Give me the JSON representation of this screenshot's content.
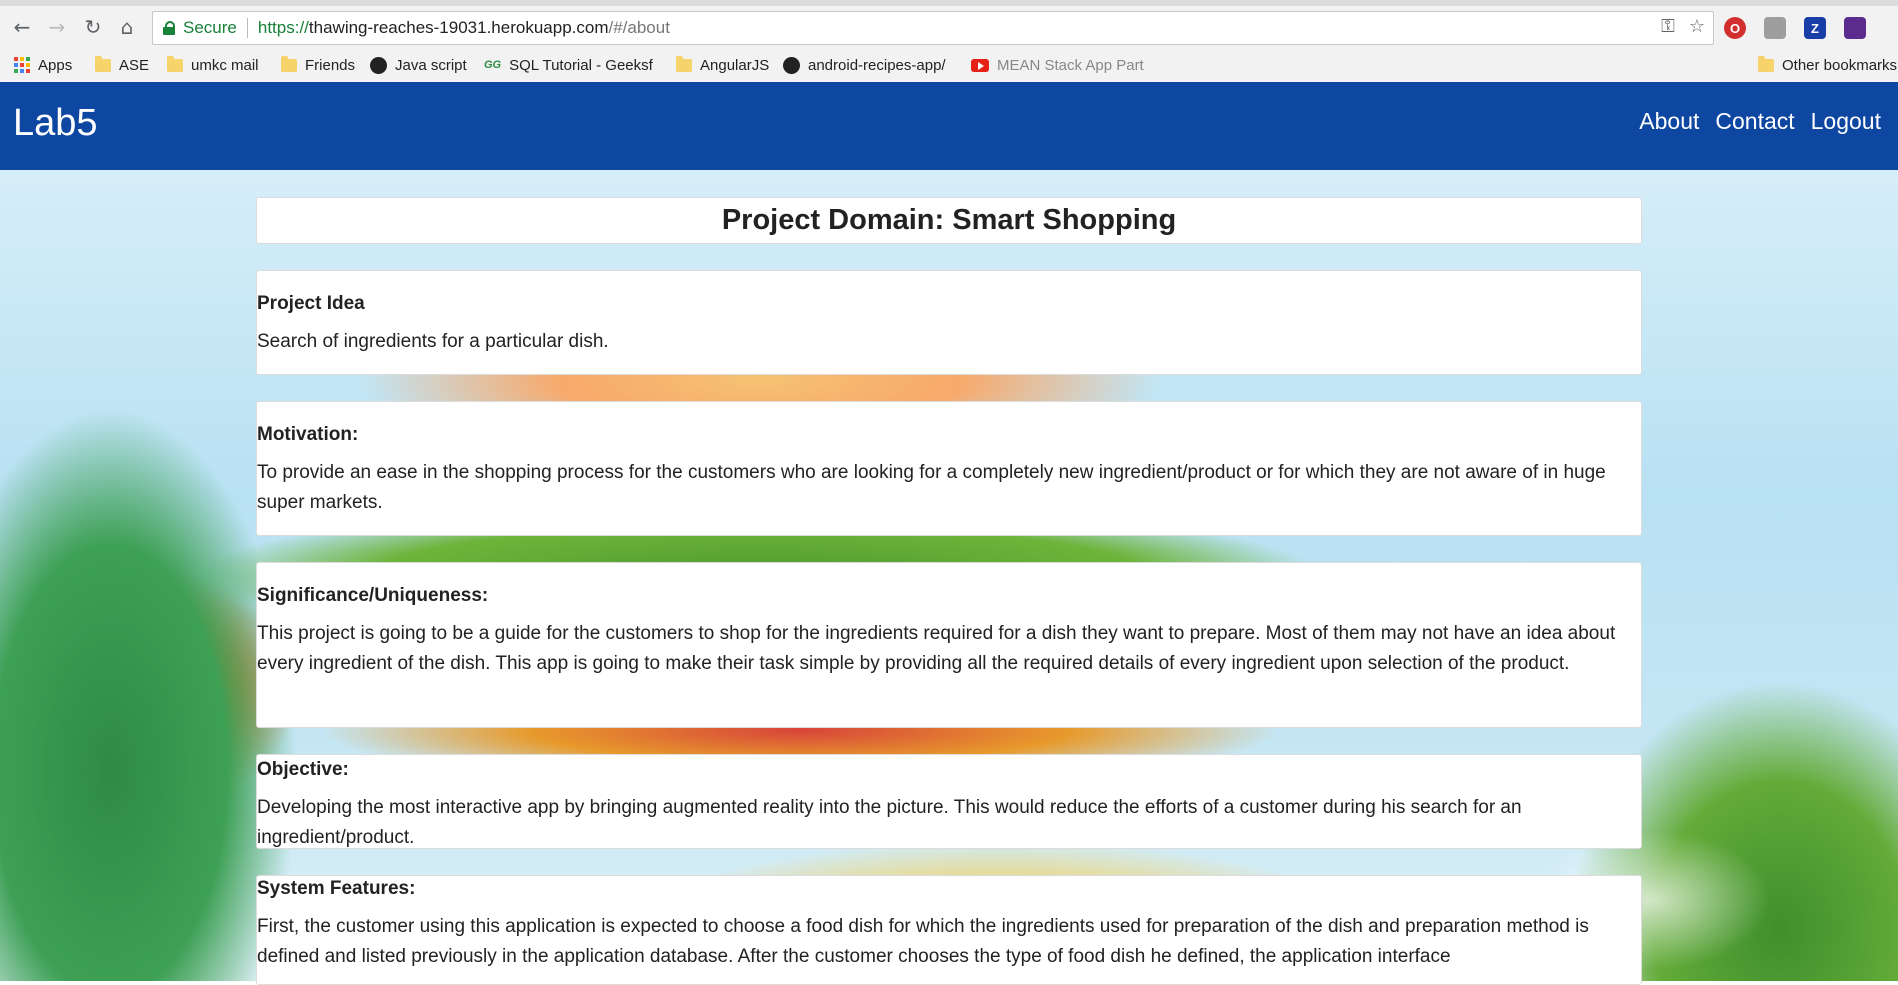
{
  "browser": {
    "security_label": "Secure",
    "url_scheme": "https://",
    "url_host": "thawing-reaches-19031.herokuapp.com",
    "url_path": "/#/about",
    "bookmarks": [
      "Apps",
      "ASE",
      "umkc mail",
      "Friends",
      "Java script",
      "SQL Tutorial - Geeksf",
      "AngularJS",
      "android-recipes-app/",
      "MEAN Stack App Part"
    ],
    "other_bookmarks": "Other bookmarks",
    "extensions": [
      "O",
      "",
      "Z",
      ""
    ]
  },
  "navbar": {
    "brand": "Lab5",
    "links": [
      "About",
      "Contact",
      "Logout"
    ]
  },
  "page": {
    "title": "Project Domain: Smart Shopping",
    "sections": [
      {
        "heading": "Project Idea",
        "body": "Search of ingredients for a particular dish."
      },
      {
        "heading": "Motivation:",
        "body": "To provide an ease in the shopping process for the customers who are looking for a completely new ingredient/product or for which they are not aware of in huge super markets."
      },
      {
        "heading": "Significance/Uniqueness:",
        "body": "This project is going to be a guide for the customers to shop for the ingredients required for a dish they want to prepare. Most of them may not have an idea about every ingredient of the dish. This app is going to make their task simple by providing all the required details of every ingredient upon selection of the product."
      },
      {
        "heading": "Objective:",
        "body": "Developing the most interactive app by bringing augmented reality into the picture. This would reduce the efforts of a customer during his search for an ingredient/product."
      },
      {
        "heading": "System Features:",
        "body": "First, the customer using this application is expected to choose a food dish for which the ingredients used for preparation of the dish and preparation method is defined and listed previously in the application database. After the customer chooses the type of food dish he defined, the application interface"
      }
    ]
  }
}
